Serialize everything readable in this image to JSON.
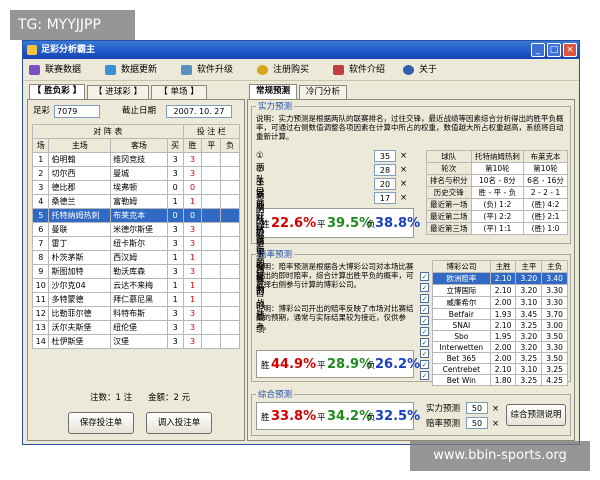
{
  "overlay": {
    "tag": "TG: MYYJJPP",
    "watermark": "www.bbin-sports.org"
  },
  "window": {
    "title": "足彩分析霸主",
    "buttons": [
      "_",
      "□",
      "×"
    ]
  },
  "menu": [
    "联赛数据",
    "数据更新",
    "软件升级",
    "注册购买",
    "软件介绍",
    "关于"
  ],
  "left": {
    "tabs": [
      "【 胜负彩 】",
      "【 进球彩 】",
      "【 单场 】"
    ],
    "lottery_label": "足彩",
    "lottery_value": "7079",
    "deadline_label": "截止日期",
    "deadline_value": "2007. 10. 27",
    "headers": {
      "match": "对 阵 表",
      "bet": "投 注 栏",
      "no": "场",
      "home": "主场",
      "away": "客场",
      "buy": "买",
      "w": "胜",
      "d": "平",
      "l": "负"
    },
    "rows": [
      {
        "no": "1",
        "home": "伯明翰",
        "away": "维冈竞技",
        "buy": "3",
        "pick": "3"
      },
      {
        "no": "2",
        "home": "切尔西",
        "away": "曼城",
        "buy": "3",
        "pick": "3"
      },
      {
        "no": "3",
        "home": "德比郡",
        "away": "埃弗顿",
        "buy": "0",
        "pick": "0"
      },
      {
        "no": "4",
        "home": "桑德兰",
        "away": "富勒姆",
        "buy": "1",
        "pick": "1"
      },
      {
        "no": "5",
        "home": "托特纳姆热刺",
        "away": "布莱克本",
        "buy": "0",
        "pick": "0"
      },
      {
        "no": "6",
        "home": "曼联",
        "away": "米德尔斯堡",
        "buy": "3",
        "pick": "3"
      },
      {
        "no": "7",
        "home": "雷丁",
        "away": "纽卡斯尔",
        "buy": "3",
        "pick": "3"
      },
      {
        "no": "8",
        "home": "朴茨茅斯",
        "away": "西汉姆",
        "buy": "1",
        "pick": "1"
      },
      {
        "no": "9",
        "home": "斯图加特",
        "away": "勒沃库森",
        "buy": "3",
        "pick": "3"
      },
      {
        "no": "10",
        "home": "沙尔克04",
        "away": "云达不来梅",
        "buy": "1",
        "pick": "1"
      },
      {
        "no": "11",
        "home": "多特蒙德",
        "away": "拜仁慕尼黑",
        "buy": "1",
        "pick": "1"
      },
      {
        "no": "12",
        "home": "比勒菲尔德",
        "away": "科特布斯",
        "buy": "3",
        "pick": "3"
      },
      {
        "no": "13",
        "home": "沃尔夫斯堡",
        "away": "纽伦堡",
        "buy": "3",
        "pick": "3"
      },
      {
        "no": "14",
        "home": "杜伊斯堡",
        "away": "汉堡",
        "buy": "3",
        "pick": "3"
      }
    ],
    "selected_row": 4,
    "bet_count": "注数：1 注",
    "amount": "金额：2 元",
    "save_btn": "保存投注单",
    "load_btn": "调入投注单"
  },
  "right": {
    "tabs": [
      "常规预测",
      "冷门分析"
    ],
    "strength": {
      "title": "实力预测",
      "desc": "说明：实力预测是根据两队的联赛排名，过往交锋，最近战绩等因素综合分析得出的胜平负概率，可通过右侧数值调整各项因素在计算中所占的权重，数值越大所占权重越高，系统将自动重新计算。",
      "factors": [
        {
          "label": "①两队目前在联赛中的排名",
          "value": "35"
        },
        {
          "label": "②主客场对抗结果的影响",
          "value": "28"
        },
        {
          "label": "③两队从历史上交锋的战绩",
          "value": "20"
        },
        {
          "label": "④两队最近三场各自的战绩",
          "value": "17"
        }
      ],
      "result": {
        "win": "22.6%",
        "draw": "39.5%",
        "loss": "38.8%"
      },
      "labels": {
        "win": "胜",
        "draw": "平",
        "loss": "负"
      },
      "table": {
        "headers": [
          "球队",
          "托特纳姆热刺",
          "布莱克本"
        ],
        "rows": [
          [
            "轮次",
            "第10轮",
            "第10轮"
          ],
          [
            "排名与积分",
            "10名 - 8分",
            "6名 - 16分"
          ],
          [
            "历史交锋",
            "胜 - 平 - 负",
            "2 - 2 - 1"
          ],
          [
            "最近第一场",
            "(负) 1:2",
            "(胜) 4:2"
          ],
          [
            "最近第二场",
            "(平) 2:2",
            "(胜) 2:1"
          ],
          [
            "最近第三场",
            "(平) 1:1",
            "(胜) 1:0"
          ]
        ]
      }
    },
    "odds": {
      "title": "赔率预测",
      "desc1": "说明：赔率预测是根据各大博彩公司对本场比赛开出的即时赔率，综合计算出胜平负的概率，可选择右侧参与计算的博彩公司。",
      "desc2": "说明：博彩公司开出的赔率反映了市场对比赛结果的预期，通常与实际结果较为接近，仅供参考。",
      "result": {
        "win": "44.9%",
        "draw": "28.9%",
        "loss": "26.2%"
      },
      "headers": [
        "博彩公司",
        "主胜",
        "主平",
        "主负"
      ],
      "rows": [
        [
          "欧洲赔率",
          "2.10",
          "3.20",
          "3.40"
        ],
        [
          "立博国际",
          "2.10",
          "3.20",
          "3.30"
        ],
        [
          "威廉希尔",
          "2.00",
          "3.10",
          "3.30"
        ],
        [
          "Betfair",
          "1.93",
          "3.45",
          "3.70"
        ],
        [
          "SNAI",
          "2.10",
          "3.25",
          "3.00"
        ],
        [
          "Sbo",
          "1.95",
          "3.20",
          "3.50"
        ],
        [
          "Interwetten",
          "2.00",
          "3.20",
          "3.30"
        ],
        [
          "Bet 365",
          "2.00",
          "3.25",
          "3.50"
        ],
        [
          "Centrebet",
          "2.10",
          "3.10",
          "3.25"
        ],
        [
          "Bet Win",
          "1.80",
          "3.25",
          "4.25"
        ]
      ],
      "selected_row": 0
    },
    "combined": {
      "title": "综合预测",
      "result": {
        "win": "33.8%",
        "draw": "34.2%",
        "loss": "32.5%"
      },
      "strength_label": "实力预测",
      "strength_value": "50",
      "odds_label": "赔率预测",
      "odds_value": "50",
      "explain_btn": "综合预测说明"
    }
  },
  "colors": {
    "win": "#d40000",
    "draw": "#1e8a1e",
    "loss": "#1a3fc0",
    "select": "#316ac5",
    "title": "#1e55c8"
  }
}
